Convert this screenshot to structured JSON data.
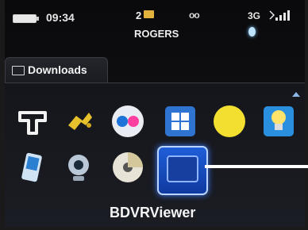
{
  "status_bar": {
    "time": "09:34",
    "message_count": "2",
    "carrier": "ROGERS",
    "network": "3G"
  },
  "folder": {
    "label": "Downloads"
  },
  "apps": [
    {
      "icon": "t-icon"
    },
    {
      "icon": "puzzle-icon"
    },
    {
      "icon": "flickr-icon"
    },
    {
      "icon": "windows-live-icon"
    },
    {
      "icon": "yellow-circle-icon"
    },
    {
      "icon": "lightbulb-icon"
    },
    {
      "icon": "device-icon"
    },
    {
      "icon": "webcam-icon"
    },
    {
      "icon": "dvd-icon"
    },
    {
      "icon": "bdvrviewer-icon"
    }
  ],
  "selected_app": {
    "name": "BDVRViewer"
  },
  "colors": {
    "selection": "#1f5ed8",
    "screen_bg": "#0f1014"
  }
}
